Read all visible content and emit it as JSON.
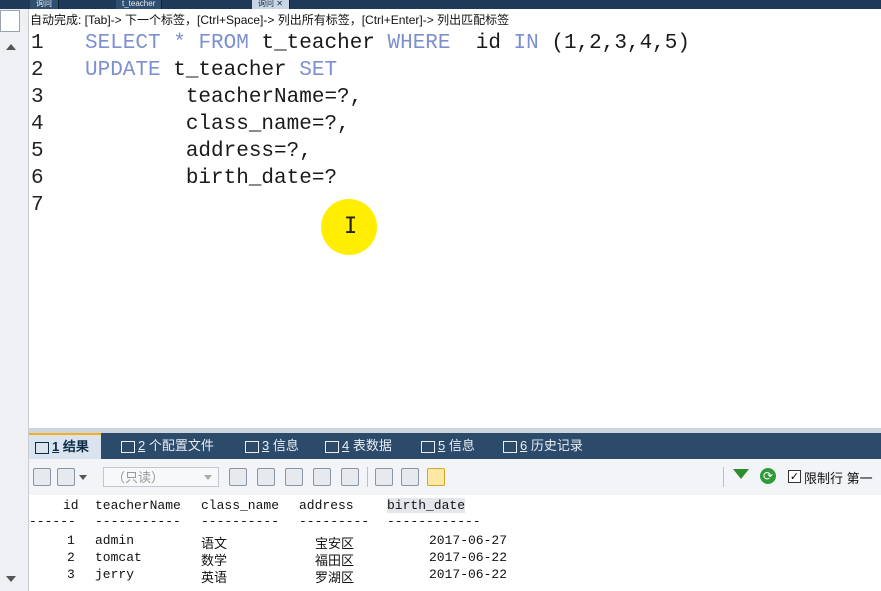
{
  "window_tabs": [
    {
      "label": "询问",
      "active": false
    },
    {
      "label": "t_teacher",
      "active": false
    },
    {
      "label": "询问",
      "active": true
    }
  ],
  "autocomplete_hint": "自动完成: [Tab]-> 下一个标签，[Ctrl+Space]-> 列出所有标签，[Ctrl+Enter]-> 列出匹配标签",
  "editor": {
    "lines": [
      {
        "num": "1",
        "tokens": [
          [
            "kw",
            "SELECT"
          ],
          [
            "t",
            " "
          ],
          [
            "kw",
            "*"
          ],
          [
            "t",
            " "
          ],
          [
            "kw",
            "FROM"
          ],
          [
            "t",
            " t_teacher "
          ],
          [
            "kw",
            "WHERE"
          ],
          [
            "t",
            "  id "
          ],
          [
            "kw",
            "IN"
          ],
          [
            "t",
            " (1,2,3,4,5)"
          ]
        ]
      },
      {
        "num": "2",
        "tokens": [
          [
            "kw",
            "UPDATE"
          ],
          [
            "t",
            " t_teacher "
          ],
          [
            "kw",
            "SET"
          ]
        ]
      },
      {
        "num": "3",
        "tokens": [
          [
            "t",
            "        teacherName=?,"
          ]
        ]
      },
      {
        "num": "4",
        "tokens": [
          [
            "t",
            "        class_name=?,"
          ]
        ]
      },
      {
        "num": "5",
        "tokens": [
          [
            "t",
            "        address=?,"
          ]
        ]
      },
      {
        "num": "6",
        "tokens": [
          [
            "t",
            "        birth_date=?"
          ]
        ]
      },
      {
        "num": "7",
        "tokens": []
      }
    ],
    "keyword_color": "#7b8fd1"
  },
  "result_tabs": [
    {
      "num": "1",
      "label": "结果",
      "icon": "result-grid-icon",
      "active": true
    },
    {
      "num": "2",
      "label": "个配置文件",
      "icon": "profile-icon",
      "active": false
    },
    {
      "num": "3",
      "label": "信息",
      "icon": "info-icon",
      "active": false
    },
    {
      "num": "4",
      "label": "表数据",
      "icon": "table-data-icon",
      "active": false
    },
    {
      "num": "5",
      "label": "信息",
      "icon": "info-chart-icon",
      "active": false
    },
    {
      "num": "6",
      "label": "历史记录",
      "icon": "history-icon",
      "active": false
    }
  ],
  "toolbar": {
    "readonly_label": "（只读）",
    "limit_rows_label": "限制行",
    "first_label": "第一",
    "limit_checked": true
  },
  "result_grid": {
    "columns": [
      "id",
      "teacherName",
      "class_name",
      "address",
      "birth_date"
    ],
    "separators": [
      "------",
      "-----------",
      "----------",
      "---------",
      "------------"
    ],
    "highlighted_column": "birth_date",
    "rows": [
      [
        "1",
        "admin",
        "语文",
        "宝安区",
        "2017-06-27"
      ],
      [
        "2",
        "tomcat",
        "数学",
        "福田区",
        "2017-06-22"
      ],
      [
        "3",
        "jerry",
        "英语",
        "罗湖区",
        "2017-06-22"
      ]
    ]
  }
}
